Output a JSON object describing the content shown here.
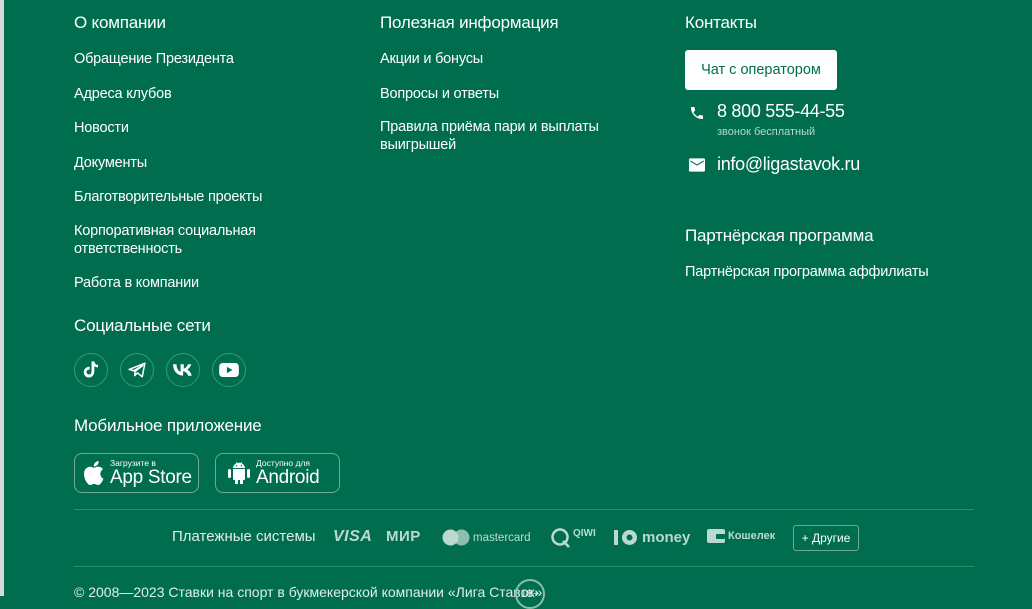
{
  "about": {
    "title": "О компании",
    "links": [
      "Обращение Президента",
      "Адреса клубов",
      "Новости",
      "Документы",
      "Благотворительные проекты",
      "Корпоративная социальная ответственность",
      "Работа в компании"
    ]
  },
  "useful": {
    "title": "Полезная информация",
    "links": [
      "Акции и бонусы",
      "Вопросы и ответы",
      "Правила приёма пари и выплаты выигрышей"
    ]
  },
  "contacts": {
    "title": "Контакты",
    "chat_button": "Чат с оператором",
    "phone": "8 800 555-44-55",
    "phone_note": "звонок бесплатный",
    "email": "info@ligastavok.ru",
    "phone_icon": "phone-icon",
    "email_icon": "envelope-icon"
  },
  "partner": {
    "title": "Партнёрская программа",
    "link": "Партнёрская программа аффилиаты"
  },
  "social": {
    "title": "Социальные сети",
    "icons": [
      "tiktok-icon",
      "telegram-icon",
      "vk-icon",
      "youtube-icon"
    ]
  },
  "mobile": {
    "title": "Мобильное приложение",
    "appstore_small": "Загрузите в",
    "appstore_big": "App Store",
    "android_small": "Доступно для",
    "android_big": "Android"
  },
  "payments": {
    "label": "Платежные системы",
    "visa": "VISA",
    "mir": "МИР",
    "mastercard": "mastercard",
    "qiwi": "QIWI",
    "money": "money",
    "koshelek": "Кошелек",
    "others_button": "+ Другие"
  },
  "footer": {
    "copyright": "© 2008—2023 Ставки на спорт в букмекерской компании «Лига Ставок»",
    "age": "18+"
  },
  "colors": {
    "background": "#006e4e",
    "accent_text": "#006e4e",
    "white": "#ffffff"
  }
}
